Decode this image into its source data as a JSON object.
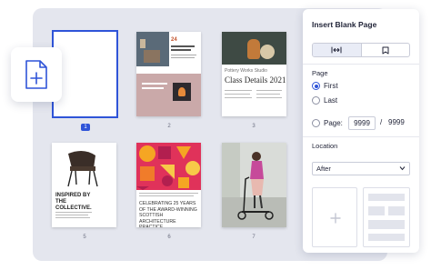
{
  "panel": {
    "title": "Insert Blank Page",
    "orientation_icons": [
      "width-arrows-icon",
      "bookmark-icon"
    ],
    "page_section_label": "Page",
    "page_options": [
      {
        "label": "First",
        "selected": true
      },
      {
        "label": "Last",
        "selected": false
      },
      {
        "label": "Page:",
        "selected": false
      }
    ],
    "page_number_value": "9999",
    "page_separator": "/",
    "page_total": "9999",
    "location_label": "Location",
    "location_value": "After",
    "layout_options": [
      "blank-plus-layout",
      "lined-layout"
    ]
  },
  "pages": [
    {
      "number": "1",
      "selected": true,
      "kind": "blank"
    },
    {
      "number": "2",
      "headline": "24",
      "kind": "interior"
    },
    {
      "number": "3",
      "top_text": "Pottery Works Studio",
      "headline": "Class Details 2021",
      "kind": "vase"
    },
    {
      "number": "5",
      "headline": "INSPIRED BY THE COLLECTIVE.",
      "kind": "chair"
    },
    {
      "number": "6",
      "headline": "CELEBRATING 25 YEARS OF THE AWARD-WINNING SCOTTISH ARCHITECTURE PRACTICE",
      "kind": "pattern"
    },
    {
      "number": "7",
      "kind": "scooter"
    }
  ],
  "colors": {
    "accent": "#2f54d8",
    "canvas": "#e4e6ee"
  }
}
